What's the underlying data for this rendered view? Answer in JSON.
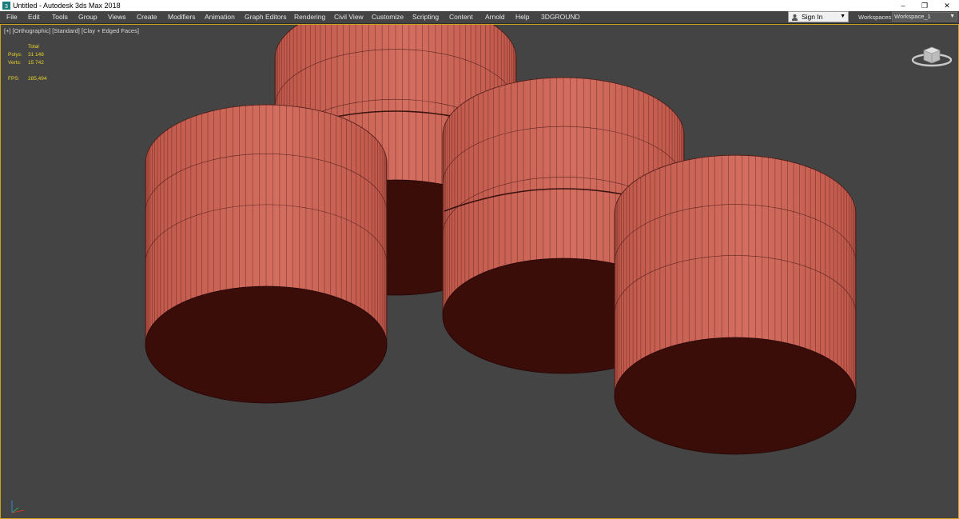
{
  "window": {
    "title": "Untitled - Autodesk 3ds Max 2018",
    "controls": {
      "minimize": "–",
      "restore": "❐",
      "close": "✕"
    }
  },
  "menu": {
    "items": [
      "File",
      "Edit",
      "Tools",
      "Group",
      "Views",
      "Create",
      "Modifiers",
      "Animation",
      "Graph Editors",
      "Rendering",
      "Civil View",
      "Customize",
      "Scripting",
      "Content",
      "Arnold",
      "Help",
      "3DGROUND"
    ]
  },
  "account": {
    "sign_in_label": "Sign In",
    "dropdown_arrow": "▼"
  },
  "workspaces": {
    "label": "Workspaces:",
    "value": "Workspace_1",
    "dropdown_arrow": "▼"
  },
  "viewport": {
    "label": {
      "plus": "[+]",
      "view": "[Orthographic]",
      "shading_preset": "[Standard]",
      "shading_mode": "[Clay + Edged Faces]"
    },
    "stats": {
      "header": "Total",
      "polys_label": "Polys:",
      "polys_value": "31 148",
      "verts_label": "Verts:",
      "verts_value": "15 742",
      "fps_label": "FPS:",
      "fps_value": "285,494"
    },
    "colors": {
      "border_active": "#c8a31a",
      "background": "#444444",
      "cylinder_side": "#c0584b",
      "cylinder_side_light": "#d36e60",
      "cylinder_bottom": "#3a0d09",
      "wire": "#4a1a14",
      "stats_text": "#e7d22a"
    },
    "icons": [
      "viewcube-icon",
      "axis-tripod-icon"
    ]
  }
}
